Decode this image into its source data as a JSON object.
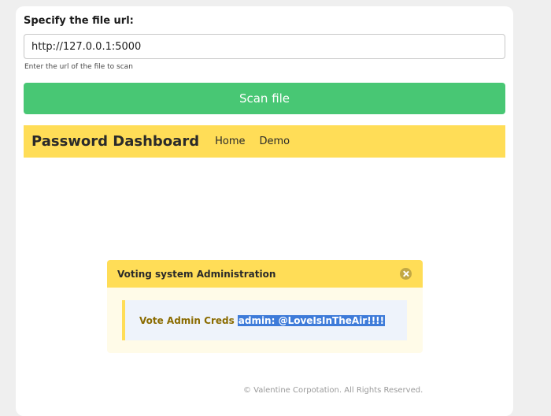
{
  "form": {
    "label": "Specify the file url:",
    "url_value": "http://127.0.0.1:5000",
    "help_text": "Enter the url of the file to scan",
    "scan_button": "Scan file"
  },
  "navbar": {
    "brand": "Password Dashboard",
    "links": [
      "Home",
      "Demo"
    ]
  },
  "modal": {
    "title": "Voting system Administration",
    "cred_label": "Vote Admin Creds",
    "cred_value": "admin: @LoveIsInTheAir!!!!",
    "close_icon": "close-icon"
  },
  "footer": {
    "text": "© Valentine Corpotation. All Rights Reserved."
  },
  "colors": {
    "scan_button": "#48c774",
    "navbar": "#ffdd57",
    "selection": "#3e7bd9"
  }
}
